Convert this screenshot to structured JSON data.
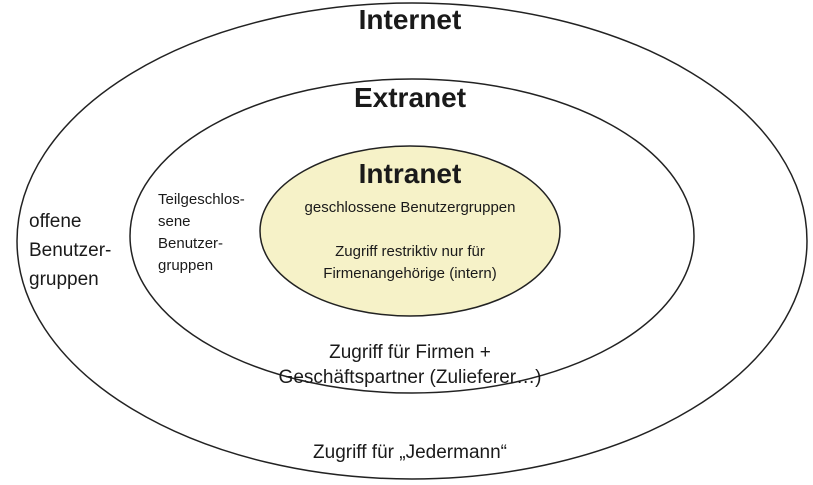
{
  "colors": {
    "ring_stroke": "#222222",
    "intranet_fill": "#f6f2c8",
    "background": "#ffffff",
    "text": "#1a1a1a"
  },
  "internet": {
    "title": "Internet",
    "side_label": "offene\nBenutzer-\ngruppen",
    "access_label": "Zugriff für „Jedermann“"
  },
  "extranet": {
    "title": "Extranet",
    "side_label": "Teilgeschlos-\nsene\nBenutzer-\ngruppen",
    "access_label": "Zugriff für Firmen +\nGeschäftspartner (Zulieferer…)"
  },
  "intranet": {
    "title": "Intranet",
    "group_label": "geschlossene Benutzergruppen",
    "access_label": "Zugriff restriktiv nur für\nFirmenangehörige (intern)"
  }
}
